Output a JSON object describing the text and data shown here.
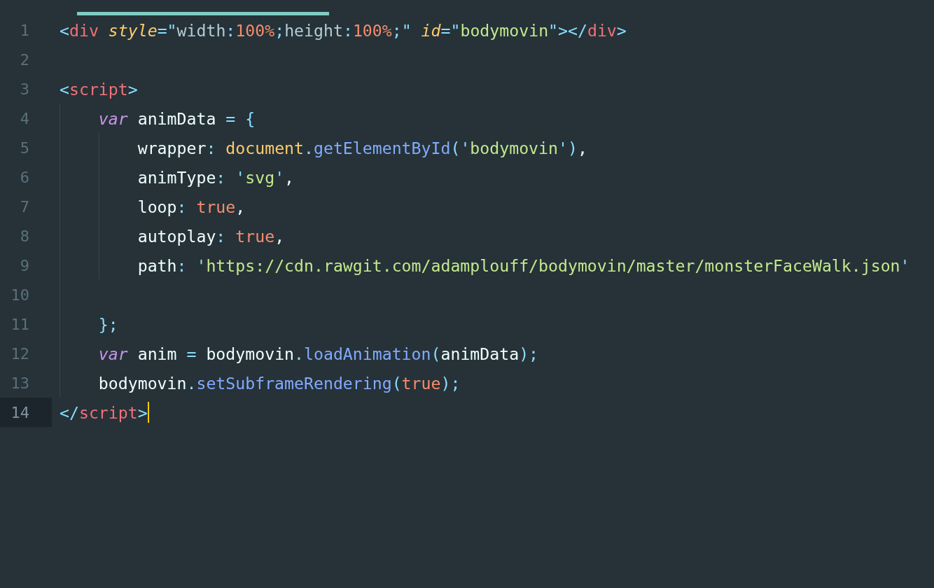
{
  "editor": {
    "lines": [
      {
        "number": "1",
        "current": false,
        "tokens": [
          {
            "kind": "punct",
            "text": "<"
          },
          {
            "kind": "tag",
            "text": "div "
          },
          {
            "kind": "attr",
            "text": "style"
          },
          {
            "kind": "punct",
            "text": "=\""
          },
          {
            "kind": "prop",
            "text": "width"
          },
          {
            "kind": "punct",
            "text": ":"
          },
          {
            "kind": "number",
            "text": "100%"
          },
          {
            "kind": "punct",
            "text": ";"
          },
          {
            "kind": "prop",
            "text": "height"
          },
          {
            "kind": "punct",
            "text": ":"
          },
          {
            "kind": "number",
            "text": "100%"
          },
          {
            "kind": "punct",
            "text": ";\" "
          },
          {
            "kind": "attr",
            "text": "id"
          },
          {
            "kind": "punct",
            "text": "=\""
          },
          {
            "kind": "string",
            "text": "bodymovin"
          },
          {
            "kind": "punct",
            "text": "\"></"
          },
          {
            "kind": "tag",
            "text": "div"
          },
          {
            "kind": "punct",
            "text": ">"
          }
        ]
      },
      {
        "number": "2",
        "current": false
      },
      {
        "number": "3",
        "current": false,
        "tokens": [
          {
            "kind": "punct",
            "text": "<"
          },
          {
            "kind": "tag",
            "text": "script"
          },
          {
            "kind": "punct",
            "text": ">"
          }
        ]
      },
      {
        "number": "4",
        "current": false,
        "tokens": [
          {
            "kind": "keyword",
            "text": "    var"
          },
          {
            "kind": "plain",
            "text": " animData "
          },
          {
            "kind": "punct",
            "text": "= {"
          }
        ]
      },
      {
        "number": "5",
        "current": false,
        "tokens": [
          {
            "kind": "plain",
            "text": "        wrapper"
          },
          {
            "kind": "punct",
            "text": ": "
          },
          {
            "kind": "object",
            "text": "document"
          },
          {
            "kind": "punct",
            "text": "."
          },
          {
            "kind": "function",
            "text": "getElementById"
          },
          {
            "kind": "punct",
            "text": "('"
          },
          {
            "kind": "string",
            "text": "bodymovin"
          },
          {
            "kind": "punct",
            "text": "')"
          },
          {
            "kind": "plain",
            "text": ","
          }
        ]
      },
      {
        "number": "6",
        "current": false,
        "tokens": [
          {
            "kind": "plain",
            "text": "        animType"
          },
          {
            "kind": "punct",
            "text": ": '"
          },
          {
            "kind": "string",
            "text": "svg"
          },
          {
            "kind": "punct",
            "text": "'"
          },
          {
            "kind": "plain",
            "text": ","
          }
        ]
      },
      {
        "number": "7",
        "current": false,
        "tokens": [
          {
            "kind": "plain",
            "text": "        loop"
          },
          {
            "kind": "punct",
            "text": ": "
          },
          {
            "kind": "number",
            "text": "true"
          },
          {
            "kind": "plain",
            "text": ","
          }
        ]
      },
      {
        "number": "8",
        "current": false,
        "tokens": [
          {
            "kind": "plain",
            "text": "        autoplay"
          },
          {
            "kind": "punct",
            "text": ": "
          },
          {
            "kind": "number",
            "text": "true"
          },
          {
            "kind": "plain",
            "text": ","
          }
        ]
      },
      {
        "number": "9",
        "current": false,
        "tokens": [
          {
            "kind": "plain",
            "text": "        path"
          },
          {
            "kind": "punct",
            "text": ": '"
          },
          {
            "kind": "string",
            "text": "https://cdn.rawgit.com/adamplouff/bodymovin/master/monsterFaceWalk.json"
          },
          {
            "kind": "punct",
            "text": "'"
          }
        ]
      },
      {
        "number": "10",
        "current": false
      },
      {
        "number": "11",
        "current": false,
        "tokens": [
          {
            "kind": "punct",
            "text": "    };"
          }
        ]
      },
      {
        "number": "12",
        "current": false,
        "tokens": [
          {
            "kind": "keyword",
            "text": "    var"
          },
          {
            "kind": "plain",
            "text": " anim "
          },
          {
            "kind": "punct",
            "text": "= "
          },
          {
            "kind": "plain",
            "text": "bodymovin"
          },
          {
            "kind": "punct",
            "text": "."
          },
          {
            "kind": "function",
            "text": "loadAnimation"
          },
          {
            "kind": "punct",
            "text": "("
          },
          {
            "kind": "plain",
            "text": "animData"
          },
          {
            "kind": "punct",
            "text": ");"
          }
        ]
      },
      {
        "number": "13",
        "current": false,
        "tokens": [
          {
            "kind": "plain",
            "text": "    bodymovin"
          },
          {
            "kind": "punct",
            "text": "."
          },
          {
            "kind": "function",
            "text": "setSubframeRendering"
          },
          {
            "kind": "punct",
            "text": "("
          },
          {
            "kind": "number",
            "text": "true"
          },
          {
            "kind": "punct",
            "text": ");"
          }
        ]
      },
      {
        "number": "14",
        "current": true,
        "tokens": [
          {
            "kind": "punct",
            "text": "</"
          },
          {
            "kind": "tag",
            "text": "script"
          },
          {
            "kind": "punct",
            "text": ">"
          }
        ]
      }
    ]
  }
}
